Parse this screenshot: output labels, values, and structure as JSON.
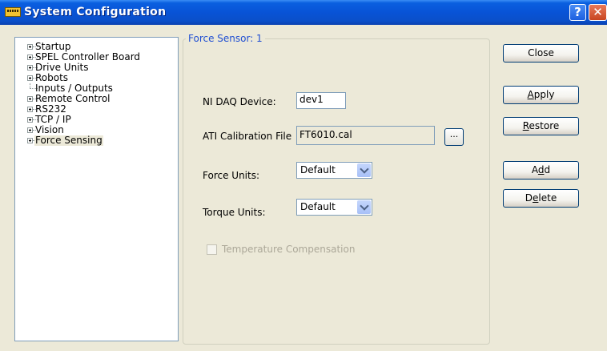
{
  "window": {
    "title": "System Configuration",
    "help_glyph": "?",
    "close_glyph": "✕"
  },
  "tree": {
    "items": [
      {
        "label": "Startup",
        "expandable": true
      },
      {
        "label": "SPEL Controller Board",
        "expandable": true
      },
      {
        "label": "Drive Units",
        "expandable": true
      },
      {
        "label": "Robots",
        "expandable": true
      },
      {
        "label": "Inputs / Outputs",
        "expandable": false
      },
      {
        "label": "Remote Control",
        "expandable": true
      },
      {
        "label": "RS232",
        "expandable": true
      },
      {
        "label": "TCP / IP",
        "expandable": true
      },
      {
        "label": "Vision",
        "expandable": true
      },
      {
        "label": "Force Sensing",
        "expandable": true,
        "selected": true
      }
    ]
  },
  "group": {
    "title": "Force Sensor: 1",
    "daq_label": "NI DAQ Device:",
    "daq_value": "dev1",
    "cal_label": "ATI Calibration File",
    "cal_value": "FT6010.cal",
    "browse_label": "...",
    "force_units_label": "Force Units:",
    "force_units_value": "Default",
    "torque_units_label": "Torque Units:",
    "torque_units_value": "Default",
    "temp_comp_label": "Temperature Compensation",
    "temp_comp_checked": false,
    "temp_comp_enabled": false
  },
  "buttons": {
    "close": "Close",
    "apply_prefix": "",
    "apply_mnemonic": "A",
    "apply_rest": "pply",
    "restore_prefix": "",
    "restore_mnemonic": "R",
    "restore_rest": "estore",
    "add_prefix": "A",
    "add_mnemonic": "d",
    "add_rest": "d",
    "delete_prefix": "D",
    "delete_mnemonic": "e",
    "delete_rest": "lete"
  },
  "colors": {
    "title_bar": "#0853d6",
    "group_title": "#1f4ed2",
    "window_bg": "#ece9d8"
  }
}
